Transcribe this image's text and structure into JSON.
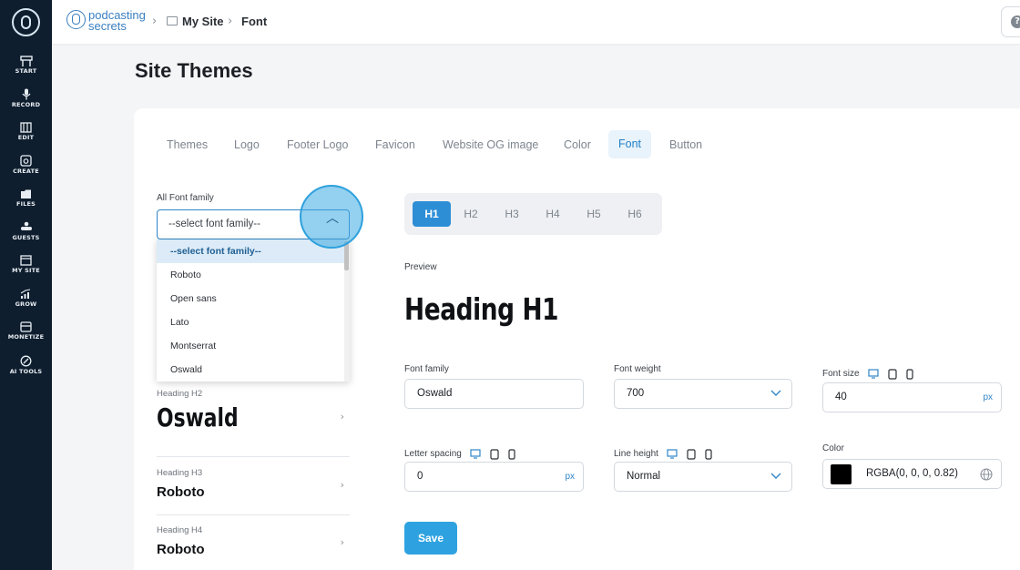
{
  "sidebar": {
    "items": [
      {
        "label": "START",
        "icon": "start-icon"
      },
      {
        "label": "RECORD",
        "icon": "microphone-icon"
      },
      {
        "label": "EDIT",
        "icon": "edit-icon"
      },
      {
        "label": "CREATE",
        "icon": "create-icon"
      },
      {
        "label": "FILES",
        "icon": "files-icon"
      },
      {
        "label": "GUESTS",
        "icon": "guests-icon"
      },
      {
        "label": "MY SITE",
        "icon": "my-site-icon"
      },
      {
        "label": "GROW",
        "icon": "grow-icon"
      },
      {
        "label": "MONETIZE",
        "icon": "monetize-icon"
      },
      {
        "label": "AI TOOLS",
        "icon": "ai-tools-icon"
      }
    ]
  },
  "topbar": {
    "brand_line1": "podcasting",
    "brand_line2": "secrets",
    "breadcrumb": [
      "My Site",
      "Font"
    ],
    "help": "?"
  },
  "page": {
    "title": "Site Themes"
  },
  "tabs": [
    "Themes",
    "Logo",
    "Footer Logo",
    "Favicon",
    "Website OG image",
    "Color",
    "Font",
    "Button"
  ],
  "active_tab": "Font",
  "font_family_select": {
    "label": "All Font family",
    "value": "--select font family--",
    "options": [
      "--select font family--",
      "Roboto",
      "Open sans",
      "Lato",
      "Montserrat",
      "Oswald"
    ]
  },
  "heading_list": [
    {
      "label": "Heading H2",
      "font": "Oswald"
    },
    {
      "label": "Heading H3",
      "font": "Roboto"
    },
    {
      "label": "Heading H4",
      "font": "Roboto"
    }
  ],
  "heading_tabs": [
    "H1",
    "H2",
    "H3",
    "H4",
    "H5",
    "H6"
  ],
  "active_heading": "H1",
  "preview": {
    "label": "Preview",
    "text": "Heading H1"
  },
  "form": {
    "font_family": {
      "label": "Font family",
      "value": "Oswald"
    },
    "font_weight": {
      "label": "Font weight",
      "value": "700"
    },
    "font_size": {
      "label": "Font size",
      "value": "40",
      "unit": "px"
    },
    "letter_spacing": {
      "label": "Letter spacing",
      "value": "0",
      "unit": "px"
    },
    "line_height": {
      "label": "Line height",
      "value": "Normal"
    },
    "color": {
      "label": "Color",
      "value": "RGBA(0, 0, 0, 0.82)",
      "swatch": "#000000"
    }
  },
  "save_label": "Save",
  "colors": {
    "accent": "#2d8ed6",
    "sidebar": "#0f1e2e"
  }
}
